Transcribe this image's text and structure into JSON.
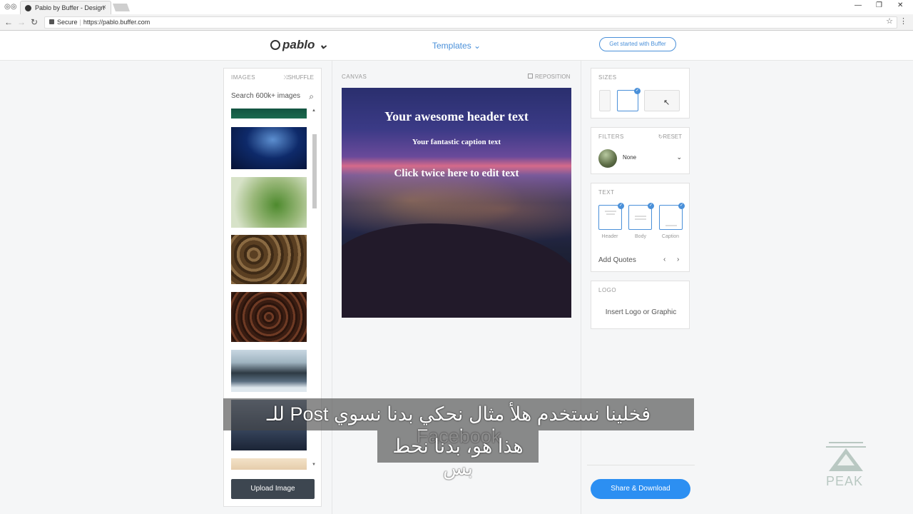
{
  "browser": {
    "tab_title": "Pablo by Buffer - Design",
    "tab_close": "×",
    "secure_label": "Secure",
    "url": "https://pablo.buffer.com",
    "minimize": "—",
    "restore": "❐",
    "close": "✕"
  },
  "header": {
    "logo": "pablo",
    "templates_label": "Templates",
    "get_started_label": "Get started with Buffer"
  },
  "images_panel": {
    "title": "IMAGES",
    "shuffle_label": "SHUFFLE",
    "search_placeholder": "Search 600k+ images",
    "upload_label": "Upload Image"
  },
  "canvas": {
    "label": "CANVAS",
    "reposition_label": "REPOSITION",
    "header_text": "Your awesome header text",
    "caption_text": "Your fantastic caption text",
    "body_text": "Click twice here to edit text"
  },
  "sizes_panel": {
    "title": "SIZES"
  },
  "filters_panel": {
    "title": "FILTERS",
    "reset_label": "RESET",
    "selected_filter": "None"
  },
  "text_panel": {
    "title": "TEXT",
    "options": [
      "Header",
      "Body",
      "Caption"
    ],
    "add_quotes_label": "Add Quotes"
  },
  "logo_panel": {
    "title": "LOGO",
    "insert_label": "Insert Logo or Graphic"
  },
  "share_label": "Share & Download",
  "subtitles": {
    "line1": "فخلينا نستخدم هلأ مثال نحكي بدنا نسوي Post للـ Facebook",
    "line2": "هذا هو، بدنا نحط بس"
  },
  "watermark": "PEAK"
}
